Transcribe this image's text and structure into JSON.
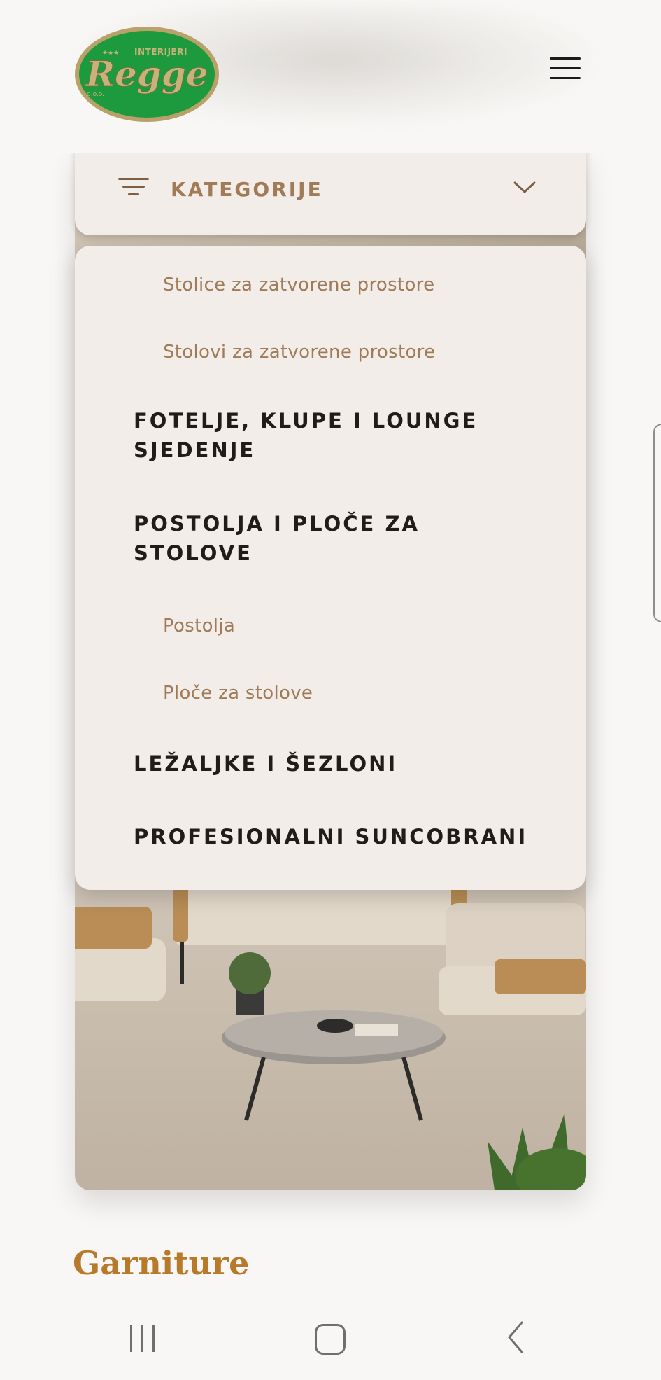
{
  "header": {
    "logo": {
      "tagline": "INTERIJERI",
      "brand": "Regge",
      "suffix": "d.o.o.",
      "stars": "★★★",
      "colors": {
        "fill": "#1d9a3e",
        "border": "#b8a26a",
        "text": "#c8b27a"
      }
    },
    "menu_icon": "hamburger-menu-icon"
  },
  "category_bar": {
    "label": "KATEGORIJE",
    "filter_icon": "filter-lines-icon",
    "chevron_icon": "chevron-down-icon"
  },
  "dropdown": {
    "items": [
      {
        "label": "Stolice za zatvorene prostore",
        "level": "sub"
      },
      {
        "label": "Stolovi za zatvorene prostore",
        "level": "sub"
      },
      {
        "label": "FOTELJE, KLUPE I LOUNGE",
        "label_line2": "SJEDENJE",
        "level": "main"
      },
      {
        "label": "POSTOLJA I PLOČE ZA",
        "label_line2": "STOLOVE",
        "level": "main"
      },
      {
        "label": "Postolja",
        "level": "sub"
      },
      {
        "label": "Ploče za stolove",
        "level": "sub"
      },
      {
        "label": "LEŽALJKE I ŠEZLONI",
        "level": "main"
      },
      {
        "label": "PROFESIONALNI SUNCOBRANI",
        "level": "main"
      }
    ]
  },
  "section": {
    "title": "Garniture"
  },
  "colors": {
    "background": "#f8f7f5",
    "panel": "#f2ede8",
    "accent_brown": "#a17b57",
    "title_gold": "#b77a2a",
    "text_dark": "#1f1c19"
  },
  "system_nav": {
    "recents_icon": "recents-icon",
    "home_icon": "home-icon",
    "back_icon": "back-icon"
  }
}
